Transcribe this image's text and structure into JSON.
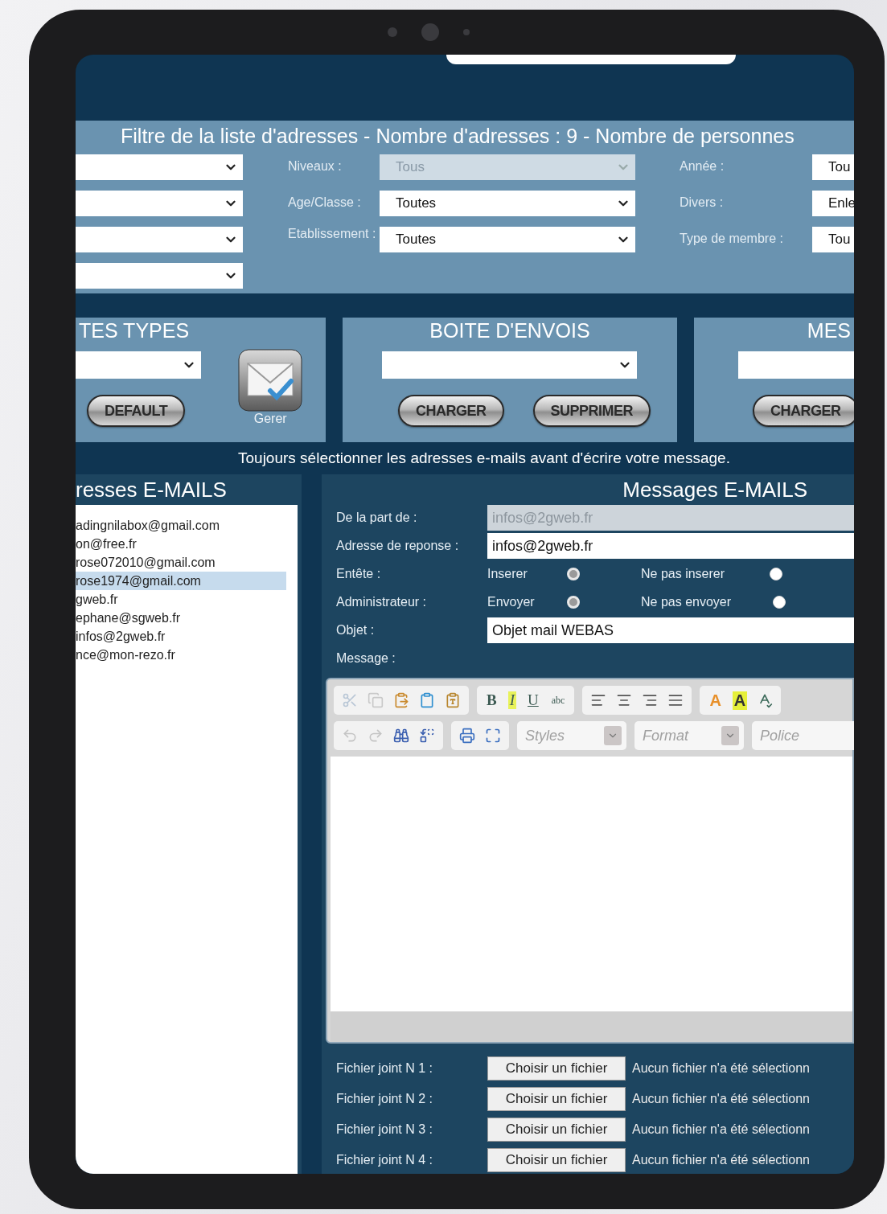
{
  "filter": {
    "title": "Filtre de la liste d'adresses - Nombre d'adresses : 9 - Nombre de personnes",
    "middle_fields": [
      {
        "label": "Niveaux :",
        "value": "Tous",
        "disabled": true
      },
      {
        "label": "Age/Classe :",
        "value": "Toutes",
        "disabled": false
      },
      {
        "label": "Etablissement :",
        "value": "Toutes",
        "disabled": false
      }
    ],
    "right_fields": [
      {
        "label": "Année :",
        "value": "Tou"
      },
      {
        "label": "Divers :",
        "value": "Enle"
      },
      {
        "label": "Type de membre :",
        "value": "Tou"
      }
    ]
  },
  "panels": [
    {
      "title": "TES TYPES",
      "buttons": [
        "DEFAULT"
      ],
      "manage_label": "Gerer"
    },
    {
      "title": "BOITE D'ENVOIS",
      "buttons": [
        "CHARGER",
        "SUPPRIMER"
      ]
    },
    {
      "title": "MES",
      "buttons": [
        "CHARGER"
      ]
    }
  ],
  "notice": "Toujours sélectionner les adresses e-mails avant d'écrire votre message.",
  "address_list": {
    "title": "resses E-MAILS",
    "items": [
      {
        "text": "adingnilabox@gmail.com",
        "selected": false
      },
      {
        "text": "on@free.fr",
        "selected": false
      },
      {
        "text": "rose072010@gmail.com",
        "selected": false
      },
      {
        "text": "rose1974@gmail.com",
        "selected": true
      },
      {
        "text": "gweb.fr",
        "selected": false
      },
      {
        "text": "ephane@sgweb.fr",
        "selected": false
      },
      {
        "text": "infos@2gweb.fr",
        "selected": false
      },
      {
        "text": "nce@mon-rezo.fr",
        "selected": false
      }
    ]
  },
  "message": {
    "title": "Messages E-MAILS",
    "from": {
      "label": "De la part de :",
      "value": "infos@2gweb.fr",
      "disabled": true
    },
    "reply_to": {
      "label": "Adresse de reponse :",
      "value": "infos@2gweb.fr",
      "disabled": false
    },
    "radio_groups": [
      {
        "label": "Entête :",
        "options": [
          {
            "label": "Inserer",
            "selected": true
          },
          {
            "label": "Ne pas inserer",
            "selected": false
          }
        ]
      },
      {
        "label": "Administrateur :",
        "options": [
          {
            "label": "Envoyer",
            "selected": true
          },
          {
            "label": "Ne pas envoyer",
            "selected": false
          }
        ]
      }
    ],
    "subject": {
      "label": "Objet :",
      "value": "Objet mail WEBAS"
    },
    "message_label": "Message :",
    "editor": {
      "format_buttons": [
        "B",
        "I",
        "U",
        "abc"
      ],
      "color_buttons": [
        "A",
        "A"
      ],
      "combos": [
        "Styles",
        "Format",
        "Police"
      ]
    },
    "attachments": [
      {
        "label": "Fichier joint N 1 :",
        "button": "Choisir un fichier",
        "status": "Aucun fichier n'a été sélectionn"
      },
      {
        "label": "Fichier joint N 2 :",
        "button": "Choisir un fichier",
        "status": "Aucun fichier n'a été sélectionn"
      },
      {
        "label": "Fichier joint N 3 :",
        "button": "Choisir un fichier",
        "status": "Aucun fichier n'a été sélectionn"
      },
      {
        "label": "Fichier joint N 4 :",
        "button": "Choisir un fichier",
        "status": "Aucun fichier n'a été sélectionn"
      }
    ]
  }
}
